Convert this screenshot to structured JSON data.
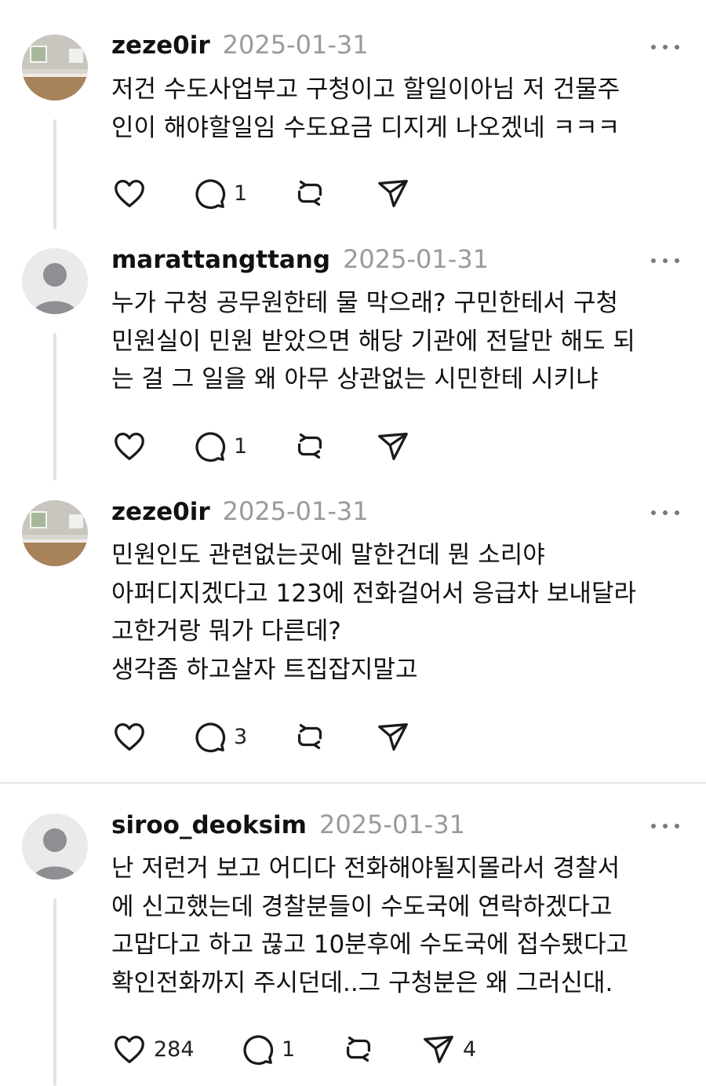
{
  "posts": [
    {
      "username": "zeze0ir",
      "date": "2025-01-31",
      "avatar": "room-photo",
      "lines": [
        "저건 수도사업부고 구청이고 할일이아님 저 건물주",
        "인이 해야할일임 수도요금 디지게 나오겠네 ㅋㅋㅋ"
      ],
      "likes": "",
      "replies": "1",
      "shares": ""
    },
    {
      "username": "marattangttang",
      "date": "2025-01-31",
      "avatar": "default-person",
      "lines": [
        "누가 구청 공무원한테 물 막으래? 구민한테서 구청",
        "민원실이 민원 받았으면 해당 기관에 전달만 해도 되",
        "는 걸 그 일을 왜 아무 상관없는 시민한테 시키냐"
      ],
      "likes": "",
      "replies": "1",
      "shares": ""
    },
    {
      "username": "zeze0ir",
      "date": "2025-01-31",
      "avatar": "room-photo",
      "lines": [
        "민원인도 관련없는곳에 말한건데 뭔 소리야",
        "아퍼디지겠다고 123에 전화걸어서 응급차 보내달라",
        "고한거랑 뭐가 다른데?",
        "생각좀 하고살자 트집잡지말고"
      ],
      "likes": "",
      "replies": "3",
      "shares": ""
    },
    {
      "username": "siroo_deoksim",
      "date": "2025-01-31",
      "avatar": "default-person",
      "lines": [
        "난 저런거 보고 어디다 전화해야될지몰라서 경찰서",
        "에 신고했는데 경찰분들이 수도국에 연락하겠다고",
        "고맙다고 하고 끊고 10분후에 수도국에 접수됐다고",
        "확인전화까지 주시던데..그 구청분은 왜 그러신대."
      ],
      "likes": "284",
      "replies": "1",
      "shares": "4"
    }
  ],
  "icons": {
    "like": "heart-icon",
    "reply": "comment-icon",
    "repost": "repost-icon",
    "share": "send-icon",
    "more": "more-dots-icon"
  },
  "colors": {
    "text": "#111111",
    "muted": "#9a9a9a",
    "divider": "#e6e6e6"
  }
}
